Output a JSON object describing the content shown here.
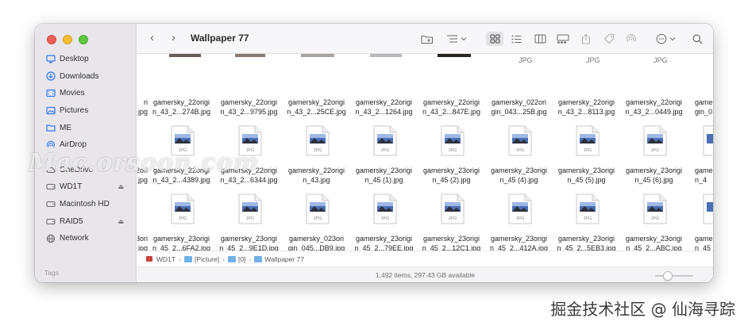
{
  "window": {
    "title": "Wallpaper 77"
  },
  "sidebar": {
    "items": [
      {
        "label": "Desktop",
        "icon": "desktop-icon"
      },
      {
        "label": "Downloads",
        "icon": "downloads-icon"
      },
      {
        "label": "Movies",
        "icon": "movies-icon"
      },
      {
        "label": "Pictures",
        "icon": "pictures-icon"
      },
      {
        "label": "ME",
        "icon": "folder-icon"
      },
      {
        "label": "AirDrop",
        "icon": "airdrop-icon"
      }
    ],
    "locations": [
      {
        "label": "OneDrive",
        "icon": "cloud-icon"
      },
      {
        "label": "WD1T",
        "icon": "drive-icon",
        "eject": true
      },
      {
        "label": "Macintosh HD",
        "icon": "drive-icon"
      },
      {
        "label": "RAID5",
        "icon": "drive-icon",
        "eject": true
      },
      {
        "label": "Network",
        "icon": "network-icon"
      }
    ],
    "tags_label": "Tags"
  },
  "toolbar": {
    "icons": [
      "back-icon",
      "forward-icon",
      "new-folder-icon",
      "group-by-icon",
      "icon-view-icon",
      "list-view-icon",
      "column-view-icon",
      "gallery-view-icon",
      "share-icon",
      "tag-icon",
      "airdrop-icon",
      "more-actions-icon",
      "search-icon"
    ]
  },
  "files": {
    "row1": [
      {
        "name1": "gamersky_22origi",
        "name2": "n_43_2...274B.jpg"
      },
      {
        "name1": "gamersky_22origi",
        "name2": "n_43_2...9795.jpg"
      },
      {
        "name1": "gamersky_22origi",
        "name2": "n_43_2...25CE.jpg"
      },
      {
        "name1": "gamersky_22origi",
        "name2": "n_43_2...1264.jpg"
      },
      {
        "name1": "gamersky_22origi",
        "name2": "n_43_2...847E.jpg"
      },
      {
        "name1": "gamersky_022ori",
        "name2": "gin_043...25B.jpg"
      },
      {
        "name1": "gamersky_22origi",
        "name2": "n_43_2...8113.jpg"
      },
      {
        "name1": "gamersky_22origi",
        "name2": "n_43_2...0449.jpg"
      }
    ],
    "row1_edge": {
      "left1": "ri",
      "left2": ".jpg",
      "right1": "game",
      "right2": "gin_0"
    },
    "row2": [
      {
        "name1": "gamersky_22origi",
        "name2": "n_43_2...4389.jpg"
      },
      {
        "name1": "gamersky_22origi",
        "name2": "n_43_2...6344.jpg"
      },
      {
        "name1": "gamersky_22origi",
        "name2": "n_43.jpg"
      },
      {
        "name1": "gamersky_23origi",
        "name2": "n_45 (1).jpg"
      },
      {
        "name1": "gamersky_23origi",
        "name2": "n_45 (2).jpg"
      },
      {
        "name1": "gamersky_23origi",
        "name2": "n_45 (4).jpg"
      },
      {
        "name1": "gamersky_23origi",
        "name2": "n_45 (5).jpg"
      },
      {
        "name1": "gamersky_23origi",
        "name2": "n_45 (6).jpg"
      }
    ],
    "row2_edge": {
      "left1": "2ori",
      "left2": ".jpg",
      "right1": "game",
      "right2": "n_4"
    },
    "row3": [
      {
        "name1": "gamersky_23origi",
        "name2": "n_45_2...6FA2.jpg"
      },
      {
        "name1": "gamersky_23origi",
        "name2": "n_45_2...9E1D.jpg"
      },
      {
        "name1": "gamersky_023ori",
        "name2": "gin_045...DB9.jpg"
      },
      {
        "name1": "gamersky_23origi",
        "name2": "n_45_2...79EE.jpg"
      },
      {
        "name1": "gamersky_23origi",
        "name2": "n_45_2...12C1.jpg"
      },
      {
        "name1": "gamersky_23origi",
        "name2": "n_45_2...412A.jpg"
      },
      {
        "name1": "gamersky_23origi",
        "name2": "n_45_2...5EB3.jpg"
      },
      {
        "name1": "gamersky_23origi",
        "name2": "n_45_2...ABC.jpg"
      }
    ],
    "row3_edge": {
      "left1": "3ori",
      "left2": ".jpg",
      "right1": "game",
      "right2": "n_45"
    },
    "thumb_label": "JPG"
  },
  "pathbar": {
    "segments": [
      "WD1T",
      "[Picture]",
      "[0]",
      "Wallpaper 77"
    ]
  },
  "status": {
    "text": "1,492 items, 297.43 GB available"
  },
  "overlay": {
    "watermark": "Mac.orsoon.com",
    "credit": "掘金技术社区 @ 仙海寻踪"
  },
  "colors": {
    "accent": "#3478f6",
    "folder": "#6fb0e8",
    "sidebar_bg": "#e8e6ea"
  }
}
